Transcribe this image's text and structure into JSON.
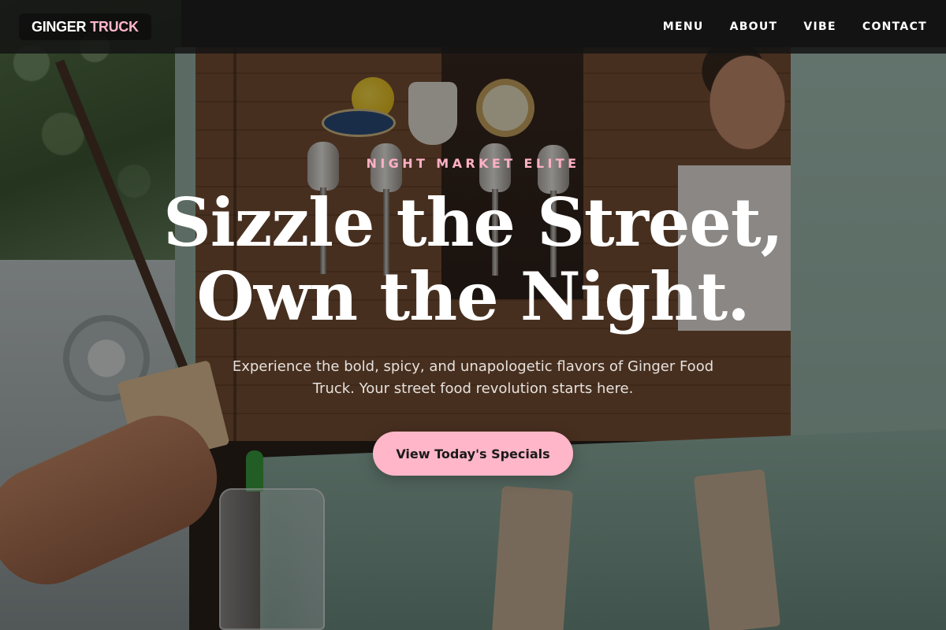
{
  "navbar": {
    "brand_part1": "GINGER",
    "brand_part2": "TRUCK",
    "links": [
      {
        "label": "MENU"
      },
      {
        "label": "ABOUT"
      },
      {
        "label": "VIBE"
      },
      {
        "label": "CONTACT"
      }
    ]
  },
  "hero": {
    "eyebrow": "NIGHT MARKET ELITE",
    "headline_line1": "Sizzle the Street,",
    "headline_line2": "Own the Night.",
    "subtitle": "Experience the bold, spicy, and unapologetic flavors of Ginger Food Truck. Your street food revolution starts here.",
    "cta_label": "View Today's Specials",
    "background_image": "food-truck-serving-window-photo"
  },
  "colors": {
    "accent_pink": "#ffb6c8",
    "eyebrow_pink": "#ffb0c4",
    "nav_background": "#141414",
    "text_white": "#ffffff"
  }
}
